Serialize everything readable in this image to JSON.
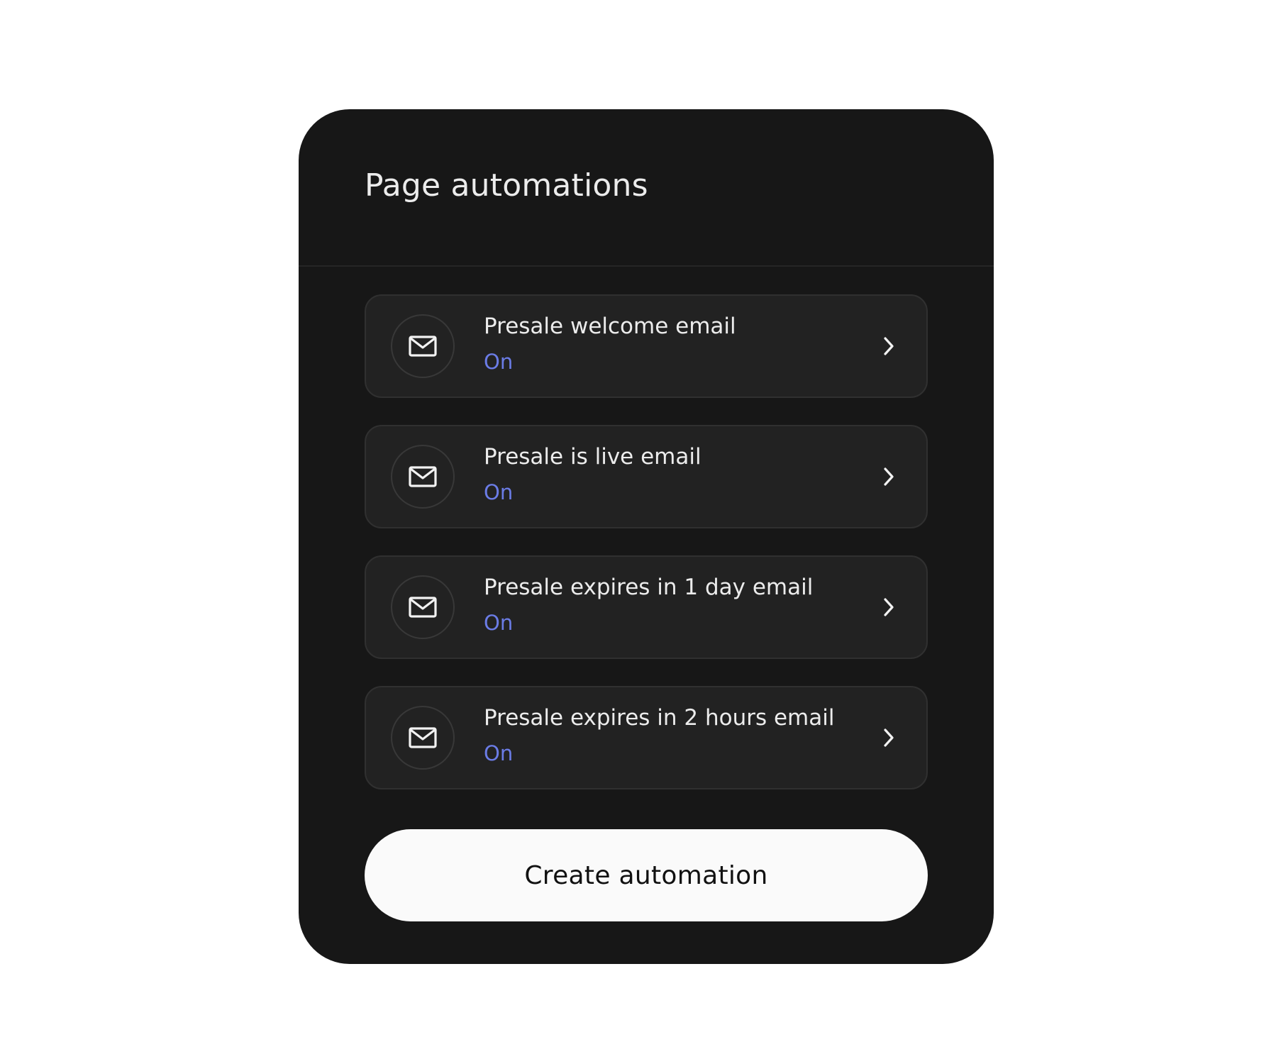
{
  "panel": {
    "title": "Page automations"
  },
  "automations": [
    {
      "title": "Presale welcome email",
      "status": "On",
      "icon": "mail-icon"
    },
    {
      "title": "Presale is live email",
      "status": "On",
      "icon": "mail-icon"
    },
    {
      "title": "Presale expires in 1 day email",
      "status": "On",
      "icon": "mail-icon"
    },
    {
      "title": "Presale expires in 2 hours email",
      "status": "On",
      "icon": "mail-icon"
    }
  ],
  "actions": {
    "create_label": "Create automation"
  },
  "colors": {
    "panel_bg": "#171717",
    "card_bg": "#222222",
    "status_on": "#6b7ce6",
    "button_bg": "#fafafa"
  }
}
